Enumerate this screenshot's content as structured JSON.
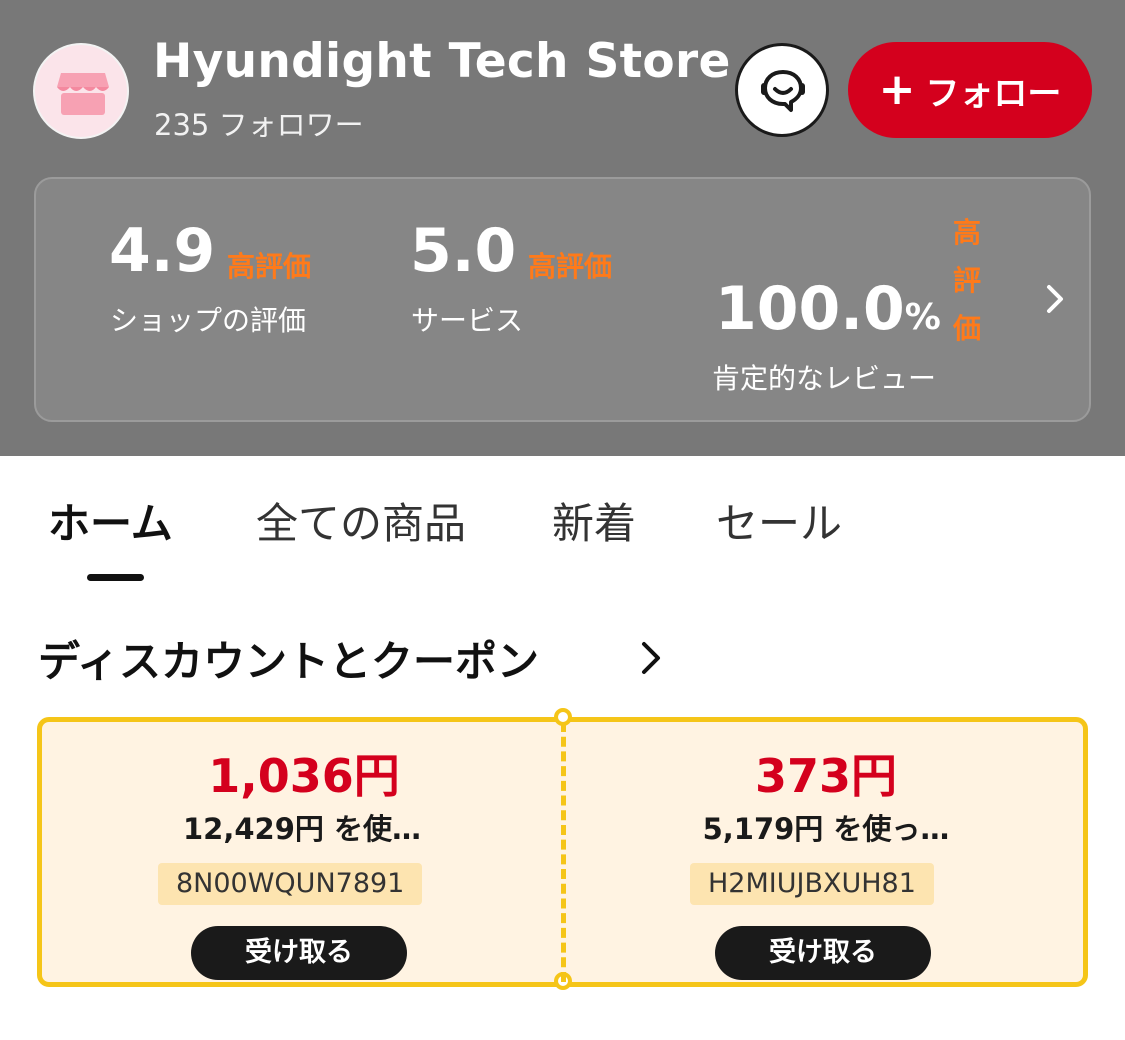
{
  "store": {
    "name": "Hyundight Tech Store",
    "followers": "235 フォロワー",
    "follow_label": "フォロー",
    "avatar_icon": "storefront-icon",
    "chat_icon": "chat-support-icon"
  },
  "stats": {
    "shop_rating": {
      "value": "4.9",
      "tag": "高評価",
      "label": "ショップの評価"
    },
    "service": {
      "value": "5.0",
      "tag": "高評価",
      "label": "サービス"
    },
    "positive_review": {
      "value": "100.0",
      "unit": "%",
      "tag_chars": [
        "高",
        "評",
        "価"
      ],
      "label": "肯定的なレビュー"
    }
  },
  "tabs": [
    {
      "label": "ホーム",
      "active": true
    },
    {
      "label": "全ての商品",
      "active": false
    },
    {
      "label": "新着",
      "active": false
    },
    {
      "label": "セール",
      "active": false
    }
  ],
  "section": {
    "title": "ディスカウントとクーポン"
  },
  "coupons": [
    {
      "amount": "1,036円",
      "condition": "12,429円 を使…",
      "code": "8N00WQUN7891",
      "button": "受け取る"
    },
    {
      "amount": "373円",
      "condition": "5,179円 を使っ…",
      "code": "H2MIUJBXUH81",
      "button": "受け取る"
    }
  ],
  "colors": {
    "header_bg": "#787878",
    "accent_red": "#d4001d",
    "rating_orange": "#ff7a1a",
    "coupon_border": "#f5c518",
    "coupon_bg": "#fff3e2"
  }
}
